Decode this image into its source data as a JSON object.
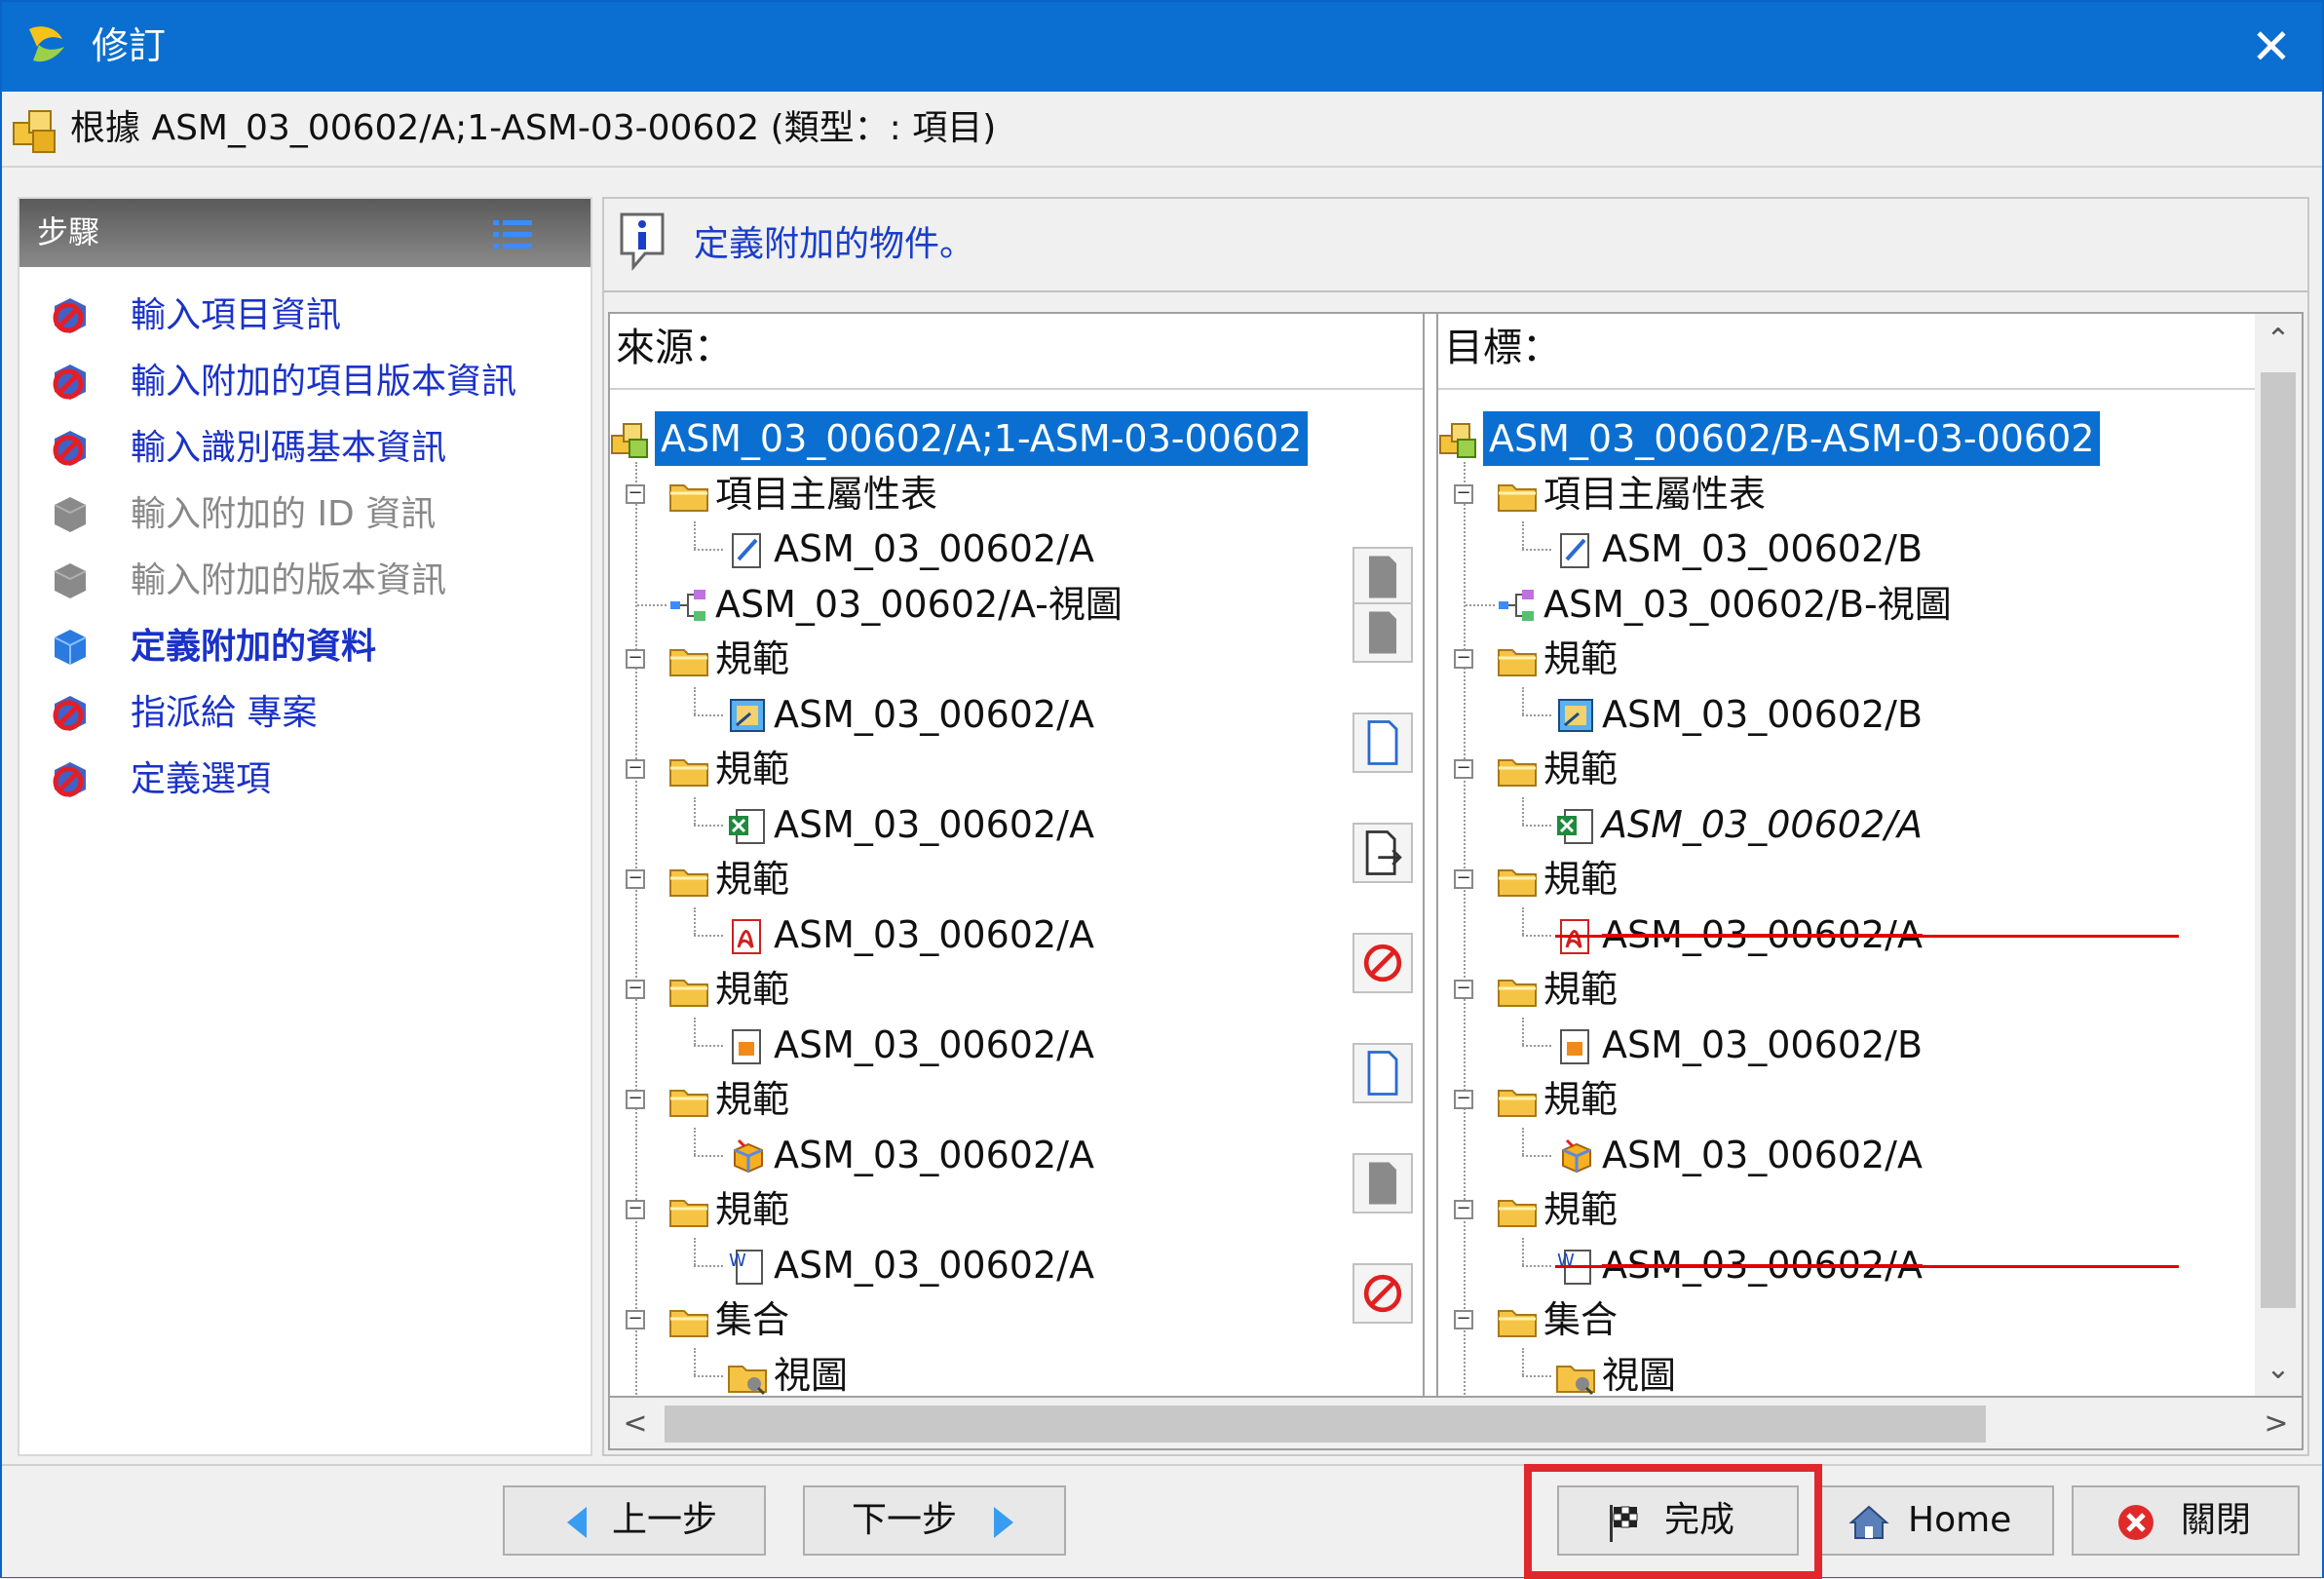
{
  "window": {
    "title": "修訂",
    "close_glyph": "✕"
  },
  "header": {
    "text": "根據 ASM_03_00602/A;1-ASM-03-00602 (類型：: 項目)"
  },
  "steps": {
    "title": "步驟",
    "items": [
      {
        "label": "輸入項目資訊",
        "state": "done"
      },
      {
        "label": "輸入附加的項目版本資訊",
        "state": "done"
      },
      {
        "label": "輸入識別碼基本資訊",
        "state": "done"
      },
      {
        "label": "輸入附加的 ID 資訊",
        "state": "disabled"
      },
      {
        "label": "輸入附加的版本資訊",
        "state": "disabled"
      },
      {
        "label": "定義附加的資料",
        "state": "current"
      },
      {
        "label": "指派給 專案",
        "state": "done"
      },
      {
        "label": "定義選項",
        "state": "done"
      }
    ]
  },
  "hint": {
    "text": "定義附加的物件。"
  },
  "source": {
    "title": "來源：",
    "root": "ASM_03_00602/A;1-ASM-03-00602",
    "nodes": [
      "項目主屬性表",
      "ASM_03_00602/A",
      "ASM_03_00602/A-視圖",
      "規範",
      "ASM_03_00602/A",
      "規範",
      "ASM_03_00602/A",
      "規範",
      "ASM_03_00602/A",
      "規範",
      "ASM_03_00602/A",
      "規範",
      "ASM_03_00602/A",
      "規範",
      "ASM_03_00602/A",
      "集合",
      "視圖"
    ]
  },
  "target": {
    "title": "目標：",
    "root": "ASM_03_00602/B-ASM-03-00602",
    "nodes": [
      "項目主屬性表",
      "ASM_03_00602/B",
      "ASM_03_00602/B-視圖",
      "規範",
      "ASM_03_00602/B",
      "規範",
      "ASM_03_00602/A",
      "規範",
      "ASM_03_00602/A",
      "規範",
      "ASM_03_00602/B",
      "規範",
      "ASM_03_00602/A",
      "規範",
      "ASM_03_00602/A",
      "集合",
      "視圖"
    ]
  },
  "scroll": {
    "up": "⌃",
    "down": "⌄",
    "left": "<",
    "right": ">"
  },
  "buttons": {
    "back": "上一步",
    "next": "下一步",
    "finish": "完成",
    "home": "Home",
    "close": "關閉"
  },
  "colors": {
    "titlebar": "#0a6fd0",
    "selection": "#0a6fd0",
    "highlight": "#e0282c",
    "link": "#1a32c8"
  }
}
